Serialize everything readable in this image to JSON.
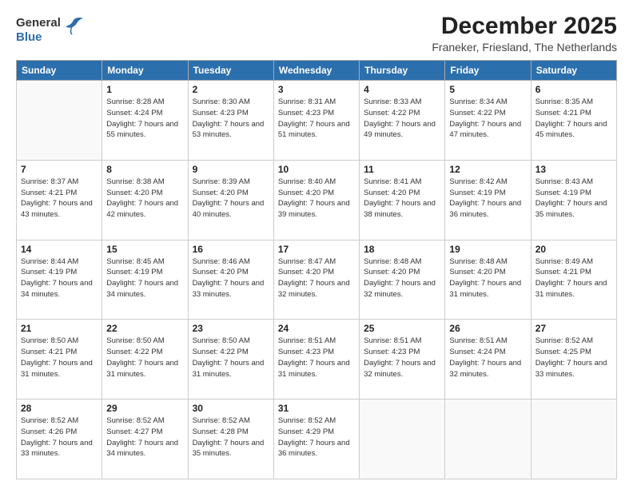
{
  "logo": {
    "general": "General",
    "blue": "Blue"
  },
  "title": "December 2025",
  "subtitle": "Franeker, Friesland, The Netherlands",
  "weekdays": [
    "Sunday",
    "Monday",
    "Tuesday",
    "Wednesday",
    "Thursday",
    "Friday",
    "Saturday"
  ],
  "weeks": [
    [
      {
        "day": "",
        "empty": true
      },
      {
        "day": "1",
        "sunrise": "Sunrise: 8:28 AM",
        "sunset": "Sunset: 4:24 PM",
        "daylight": "Daylight: 7 hours and 55 minutes."
      },
      {
        "day": "2",
        "sunrise": "Sunrise: 8:30 AM",
        "sunset": "Sunset: 4:23 PM",
        "daylight": "Daylight: 7 hours and 53 minutes."
      },
      {
        "day": "3",
        "sunrise": "Sunrise: 8:31 AM",
        "sunset": "Sunset: 4:23 PM",
        "daylight": "Daylight: 7 hours and 51 minutes."
      },
      {
        "day": "4",
        "sunrise": "Sunrise: 8:33 AM",
        "sunset": "Sunset: 4:22 PM",
        "daylight": "Daylight: 7 hours and 49 minutes."
      },
      {
        "day": "5",
        "sunrise": "Sunrise: 8:34 AM",
        "sunset": "Sunset: 4:22 PM",
        "daylight": "Daylight: 7 hours and 47 minutes."
      },
      {
        "day": "6",
        "sunrise": "Sunrise: 8:35 AM",
        "sunset": "Sunset: 4:21 PM",
        "daylight": "Daylight: 7 hours and 45 minutes."
      }
    ],
    [
      {
        "day": "7",
        "sunrise": "Sunrise: 8:37 AM",
        "sunset": "Sunset: 4:21 PM",
        "daylight": "Daylight: 7 hours and 43 minutes."
      },
      {
        "day": "8",
        "sunrise": "Sunrise: 8:38 AM",
        "sunset": "Sunset: 4:20 PM",
        "daylight": "Daylight: 7 hours and 42 minutes."
      },
      {
        "day": "9",
        "sunrise": "Sunrise: 8:39 AM",
        "sunset": "Sunset: 4:20 PM",
        "daylight": "Daylight: 7 hours and 40 minutes."
      },
      {
        "day": "10",
        "sunrise": "Sunrise: 8:40 AM",
        "sunset": "Sunset: 4:20 PM",
        "daylight": "Daylight: 7 hours and 39 minutes."
      },
      {
        "day": "11",
        "sunrise": "Sunrise: 8:41 AM",
        "sunset": "Sunset: 4:20 PM",
        "daylight": "Daylight: 7 hours and 38 minutes."
      },
      {
        "day": "12",
        "sunrise": "Sunrise: 8:42 AM",
        "sunset": "Sunset: 4:19 PM",
        "daylight": "Daylight: 7 hours and 36 minutes."
      },
      {
        "day": "13",
        "sunrise": "Sunrise: 8:43 AM",
        "sunset": "Sunset: 4:19 PM",
        "daylight": "Daylight: 7 hours and 35 minutes."
      }
    ],
    [
      {
        "day": "14",
        "sunrise": "Sunrise: 8:44 AM",
        "sunset": "Sunset: 4:19 PM",
        "daylight": "Daylight: 7 hours and 34 minutes."
      },
      {
        "day": "15",
        "sunrise": "Sunrise: 8:45 AM",
        "sunset": "Sunset: 4:19 PM",
        "daylight": "Daylight: 7 hours and 34 minutes."
      },
      {
        "day": "16",
        "sunrise": "Sunrise: 8:46 AM",
        "sunset": "Sunset: 4:20 PM",
        "daylight": "Daylight: 7 hours and 33 minutes."
      },
      {
        "day": "17",
        "sunrise": "Sunrise: 8:47 AM",
        "sunset": "Sunset: 4:20 PM",
        "daylight": "Daylight: 7 hours and 32 minutes."
      },
      {
        "day": "18",
        "sunrise": "Sunrise: 8:48 AM",
        "sunset": "Sunset: 4:20 PM",
        "daylight": "Daylight: 7 hours and 32 minutes."
      },
      {
        "day": "19",
        "sunrise": "Sunrise: 8:48 AM",
        "sunset": "Sunset: 4:20 PM",
        "daylight": "Daylight: 7 hours and 31 minutes."
      },
      {
        "day": "20",
        "sunrise": "Sunrise: 8:49 AM",
        "sunset": "Sunset: 4:21 PM",
        "daylight": "Daylight: 7 hours and 31 minutes."
      }
    ],
    [
      {
        "day": "21",
        "sunrise": "Sunrise: 8:50 AM",
        "sunset": "Sunset: 4:21 PM",
        "daylight": "Daylight: 7 hours and 31 minutes."
      },
      {
        "day": "22",
        "sunrise": "Sunrise: 8:50 AM",
        "sunset": "Sunset: 4:22 PM",
        "daylight": "Daylight: 7 hours and 31 minutes."
      },
      {
        "day": "23",
        "sunrise": "Sunrise: 8:50 AM",
        "sunset": "Sunset: 4:22 PM",
        "daylight": "Daylight: 7 hours and 31 minutes."
      },
      {
        "day": "24",
        "sunrise": "Sunrise: 8:51 AM",
        "sunset": "Sunset: 4:23 PM",
        "daylight": "Daylight: 7 hours and 31 minutes."
      },
      {
        "day": "25",
        "sunrise": "Sunrise: 8:51 AM",
        "sunset": "Sunset: 4:23 PM",
        "daylight": "Daylight: 7 hours and 32 minutes."
      },
      {
        "day": "26",
        "sunrise": "Sunrise: 8:51 AM",
        "sunset": "Sunset: 4:24 PM",
        "daylight": "Daylight: 7 hours and 32 minutes."
      },
      {
        "day": "27",
        "sunrise": "Sunrise: 8:52 AM",
        "sunset": "Sunset: 4:25 PM",
        "daylight": "Daylight: 7 hours and 33 minutes."
      }
    ],
    [
      {
        "day": "28",
        "sunrise": "Sunrise: 8:52 AM",
        "sunset": "Sunset: 4:26 PM",
        "daylight": "Daylight: 7 hours and 33 minutes."
      },
      {
        "day": "29",
        "sunrise": "Sunrise: 8:52 AM",
        "sunset": "Sunset: 4:27 PM",
        "daylight": "Daylight: 7 hours and 34 minutes."
      },
      {
        "day": "30",
        "sunrise": "Sunrise: 8:52 AM",
        "sunset": "Sunset: 4:28 PM",
        "daylight": "Daylight: 7 hours and 35 minutes."
      },
      {
        "day": "31",
        "sunrise": "Sunrise: 8:52 AM",
        "sunset": "Sunset: 4:29 PM",
        "daylight": "Daylight: 7 hours and 36 minutes."
      },
      {
        "day": "",
        "empty": true
      },
      {
        "day": "",
        "empty": true
      },
      {
        "day": "",
        "empty": true
      }
    ]
  ]
}
